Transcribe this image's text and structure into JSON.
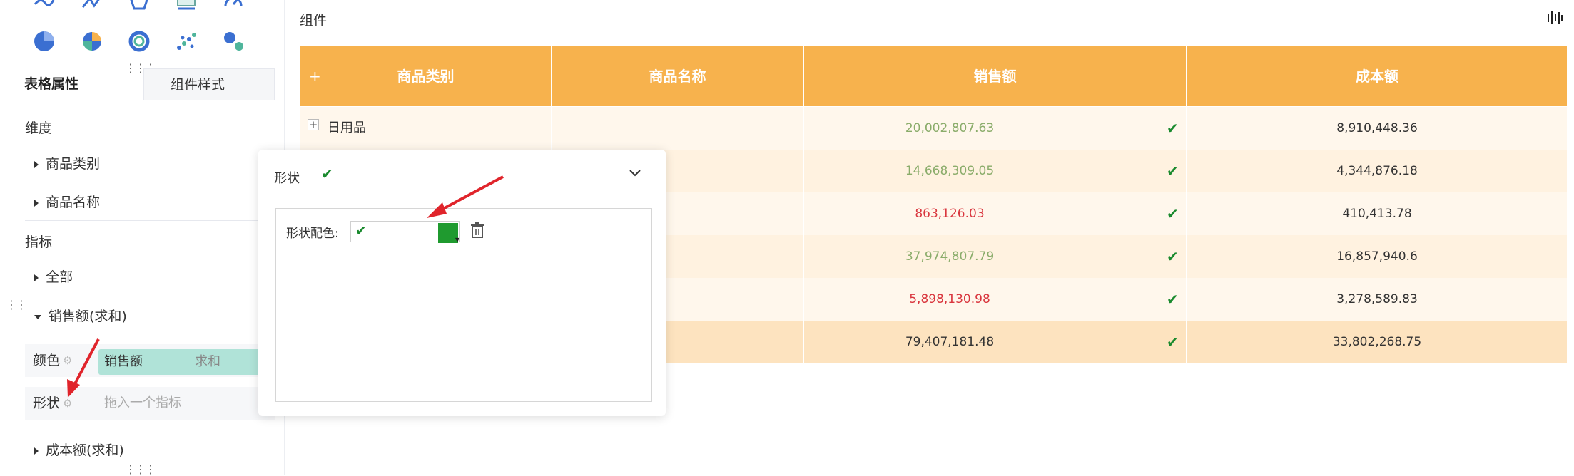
{
  "left_panel": {
    "tabs": [
      {
        "label": "表格属性",
        "active": true
      },
      {
        "label": "组件样式",
        "active": false
      }
    ],
    "dimension_section": {
      "title": "维度",
      "items": [
        {
          "label": "商品类别"
        },
        {
          "label": "商品名称"
        }
      ]
    },
    "metric_section": {
      "title": "指标",
      "items": [
        {
          "label": "全部",
          "expanded": false
        },
        {
          "label": "销售额(求和)",
          "expanded": true
        },
        {
          "label": "成本额(求和)",
          "expanded": false
        }
      ]
    },
    "color_field": {
      "label": "颜色",
      "chip_name": "销售额",
      "chip_agg": "求和"
    },
    "shape_field": {
      "label": "形状",
      "placeholder": "拖入一个指标"
    }
  },
  "main": {
    "component_title": "组件",
    "table": {
      "header": {
        "expand_symbol": "+",
        "columns": [
          "商品类别",
          "商品名称",
          "销售额",
          "成本额"
        ]
      },
      "rows": [
        {
          "category": "日用品",
          "expand_symbol": "+",
          "name": "",
          "sales": "20,002,807.63",
          "sales_color": "#8aac6a",
          "cost": "8,910,448.36"
        },
        {
          "category": "",
          "name": "",
          "sales": "14,668,309.05",
          "sales_color": "#8aac6a",
          "cost": "4,344,876.18"
        },
        {
          "category": "",
          "name": "",
          "sales": "863,126.03",
          "sales_color": "#d9363e",
          "cost": "410,413.78"
        },
        {
          "category": "",
          "name": "",
          "sales": "37,974,807.79",
          "sales_color": "#8aac6a",
          "cost": "16,857,940.6"
        },
        {
          "category": "",
          "name": "",
          "sales": "5,898,130.98",
          "sales_color": "#d9363e",
          "cost": "3,278,589.83"
        },
        {
          "category": "",
          "name": "",
          "sales": "79,407,181.48",
          "sales_color": "#333333",
          "cost": "33,802,268.75"
        }
      ]
    }
  },
  "popup": {
    "shape_label": "形状",
    "shape_color_label": "形状配色:",
    "swatch_color": "#1f9a2f"
  },
  "colors": {
    "header_bg": "#f7b24d",
    "row_light": "#fff7ec",
    "row_mid": "#fff2e0",
    "row_total": "#fde3bf",
    "check": "#1a8a2e",
    "annotation_arrow": "#e0242b"
  }
}
